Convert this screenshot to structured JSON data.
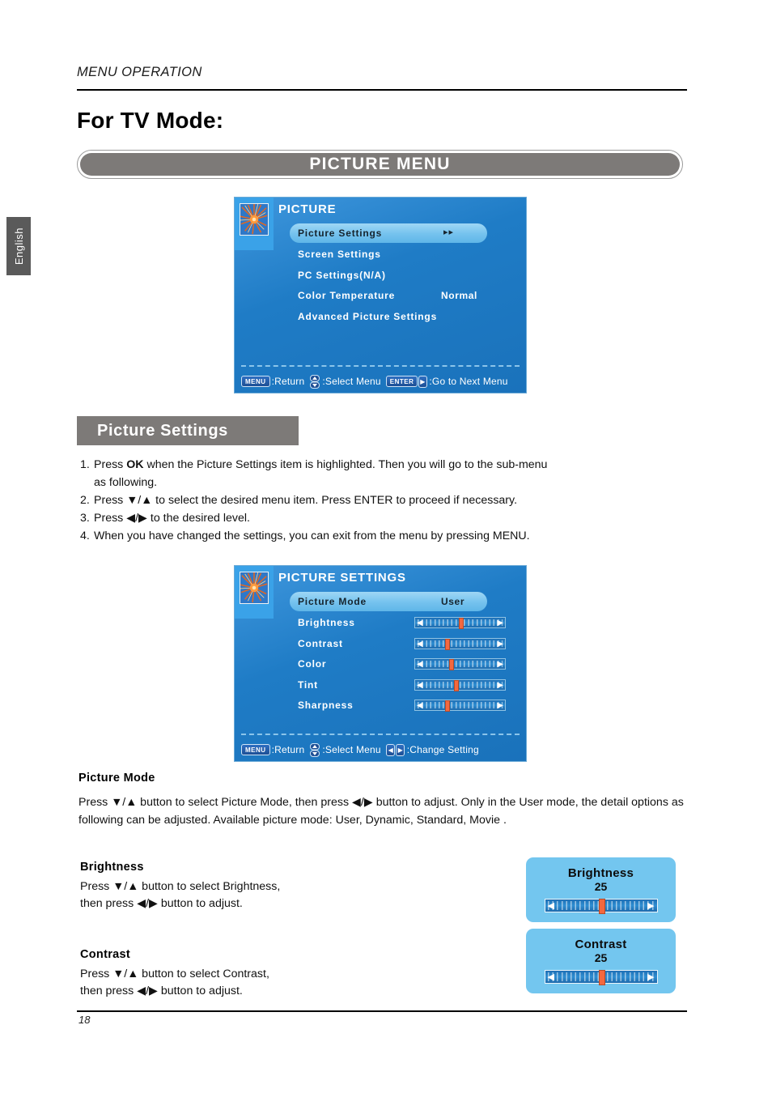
{
  "side_tab": {
    "language": "English"
  },
  "header": {
    "running_head": "MENU OPERATION",
    "heading": "For TV Mode:"
  },
  "banner": {
    "label": "PICTURE MENU"
  },
  "picture_menu_osd": {
    "title": "PICTURE",
    "thumb_icon": "picture-thumbnail-icon",
    "rows": [
      {
        "label": "Picture Settings",
        "value": "",
        "arrows": "▸▸",
        "selected": true
      },
      {
        "label": "Screen Settings",
        "value": "",
        "selected": false
      },
      {
        "label": "PC Settings(N/A)",
        "value": "",
        "selected": false
      },
      {
        "label": "Color Temperature",
        "value": "Normal",
        "selected": false
      },
      {
        "label": "Advanced Picture Settings",
        "value": "",
        "selected": false
      }
    ],
    "hints": [
      {
        "key": "MENU",
        "key_type": "cap",
        "text": ":Return"
      },
      {
        "key": "updown",
        "key_type": "updown",
        "text": ":Select Menu"
      },
      {
        "key": "ENTER",
        "key_type": "cap",
        "text": ""
      },
      {
        "key": "▶",
        "key_type": "arrow",
        "text": ":Go to Next Menu"
      }
    ]
  },
  "section": {
    "heading": "Picture Settings"
  },
  "steps": [
    {
      "num": "1.",
      "pre": "Press ",
      "bold": "OK",
      "post": " when the Picture Settings item is highlighted. Then you will go to the sub-menu",
      "cont": "as following."
    },
    {
      "num": "2.",
      "pre": "Press ▼/▲ to select the desired menu item. Press ENTER to proceed if necessary.",
      "bold": "",
      "post": "",
      "cont": ""
    },
    {
      "num": "3.",
      "pre": "Press ◀/▶ to the desired level.",
      "bold": "",
      "post": "",
      "cont": ""
    },
    {
      "num": "4.",
      "pre": "When you have changed the settings, you can exit from the menu by pressing MENU.",
      "bold": "",
      "post": "",
      "cont": ""
    }
  ],
  "picture_settings_osd": {
    "title": "PICTURE SETTINGS",
    "thumb_icon": "picture-thumbnail-icon",
    "rows": [
      {
        "label": "Picture Mode",
        "value": "User",
        "selected": true,
        "slider": null
      },
      {
        "label": "Brightness",
        "value": "",
        "selected": false,
        "slider": 50
      },
      {
        "label": "Contrast",
        "value": "",
        "selected": false,
        "slider": 30
      },
      {
        "label": "Color",
        "value": "",
        "selected": false,
        "slider": 37
      },
      {
        "label": "Tint",
        "value": "",
        "selected": false,
        "slider": 44
      },
      {
        "label": "Sharpness",
        "value": "",
        "selected": false,
        "slider": 31
      }
    ],
    "hints": [
      {
        "key": "MENU",
        "key_type": "cap",
        "text": ":Return"
      },
      {
        "key": "updown",
        "key_type": "updown",
        "text": ":Select Menu"
      },
      {
        "key": "◀",
        "key_type": "arrow",
        "text": ""
      },
      {
        "key": "▶",
        "key_type": "arrow",
        "text": ":Change Setting"
      }
    ]
  },
  "picture_mode_block": {
    "heading": "Picture Mode",
    "body": "Press ▼/▲ button to select Picture Mode, then press ◀/▶ button to adjust. Only in the User mode, the detail options as following can be adjusted. Available picture mode: User, Dynamic, Standard, Movie ."
  },
  "brightness_block": {
    "heading": "Brightness",
    "line1": "Press ▼/▲ button to select Brightness,",
    "line2": "then press ◀/▶ button to adjust."
  },
  "contrast_block": {
    "heading": "Contrast",
    "line1": "Press ▼/▲ button to select Contrast,",
    "line2": "then press ◀/▶ button to adjust."
  },
  "brightness_popup": {
    "title": "Brightness",
    "value": "25",
    "slider": 50
  },
  "contrast_popup": {
    "title": "Contrast",
    "value": "25",
    "slider": 50
  },
  "footer": {
    "page_number": "18"
  },
  "colors": {
    "banner_grey": "#7d7a78",
    "osd_blue": "#2280c8",
    "osd_sidebar_blue": "#3aa2e8",
    "osd_highlight": "#74c2ee",
    "slider_knob": "#f4683f",
    "popup_blue": "#73c6ef",
    "tab_grey": "#5a5a5a"
  }
}
